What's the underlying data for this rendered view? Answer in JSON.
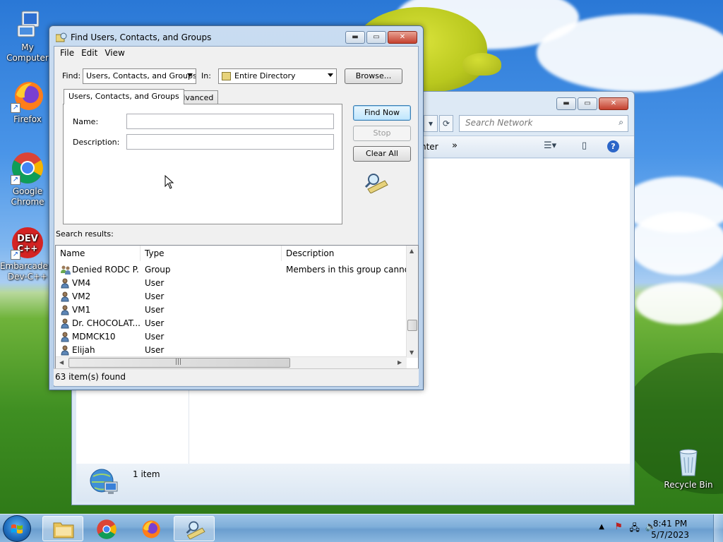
{
  "desktop": {
    "icons": [
      {
        "label": "My Computer"
      },
      {
        "label": "Firefox"
      },
      {
        "label": "Google Chrome"
      },
      {
        "label": "Embarcadero Dev-C++"
      },
      {
        "label": "Recycle Bin"
      }
    ]
  },
  "explorer": {
    "search_placeholder": "Search Network",
    "toolbar_partial_label": "nter",
    "toolbar_more": "»",
    "status_count": "1 item"
  },
  "dialog": {
    "title": "Find Users, Contacts, and Groups",
    "menu": [
      "File",
      "Edit",
      "View"
    ],
    "find_label": "Find:",
    "find_value": "Users, Contacts, and Groups",
    "in_label": "In:",
    "in_value": "Entire Directory",
    "browse_label": "Browse...",
    "tabs": [
      "Users, Contacts, and Groups",
      "Advanced"
    ],
    "name_label": "Name:",
    "name_value": "",
    "description_label": "Description:",
    "description_value": "",
    "find_now_label": "Find Now",
    "stop_label": "Stop",
    "clear_all_label": "Clear All",
    "results_label": "Search results:",
    "columns": [
      "Name",
      "Type",
      "Description"
    ],
    "rows": [
      {
        "name": "Denied RODC P...",
        "type": "Group",
        "description": "Members in this group cannot h",
        "kind": "group"
      },
      {
        "name": "VM4",
        "type": "User",
        "description": "",
        "kind": "user"
      },
      {
        "name": "VM2",
        "type": "User",
        "description": "",
        "kind": "user"
      },
      {
        "name": "VM1",
        "type": "User",
        "description": "",
        "kind": "user"
      },
      {
        "name": "Dr. CHOCOLAT...",
        "type": "User",
        "description": "",
        "kind": "user"
      },
      {
        "name": "MDMCK10",
        "type": "User",
        "description": "",
        "kind": "user"
      },
      {
        "name": "Elijah",
        "type": "User",
        "description": "",
        "kind": "user"
      }
    ],
    "status": "63 item(s) found"
  },
  "taskbar": {
    "items": [
      "windows-explorer",
      "google-chrome",
      "firefox",
      "find-users"
    ],
    "time": "8:41 PM",
    "date": "5/7/2023"
  },
  "colors": {
    "accent": "#3c7fb1",
    "taskbar": "#7eaed9"
  }
}
